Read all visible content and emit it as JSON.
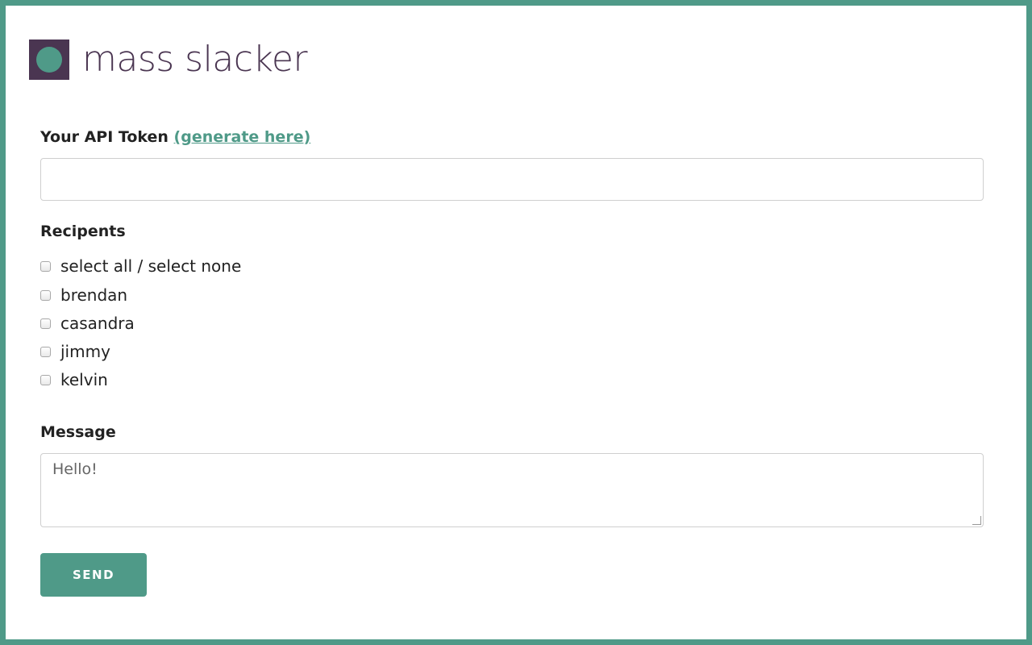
{
  "app": {
    "title": "mass slacker"
  },
  "token": {
    "label": "Your API Token",
    "link_text": "(generate here)",
    "value": ""
  },
  "recipients": {
    "label": "Recipents",
    "select_all_label": "select all / select none",
    "items": [
      {
        "name": "brendan",
        "checked": false
      },
      {
        "name": "casandra",
        "checked": false
      },
      {
        "name": "jimmy",
        "checked": false
      },
      {
        "name": "kelvin",
        "checked": false
      }
    ]
  },
  "message": {
    "label": "Message",
    "placeholder": "Hello!",
    "value": ""
  },
  "actions": {
    "send_label": "SEND"
  },
  "colors": {
    "accent": "#4f9a88",
    "brand": "#4a3551"
  },
  "icons": {
    "logo": "circle-in-square-logo-icon"
  }
}
